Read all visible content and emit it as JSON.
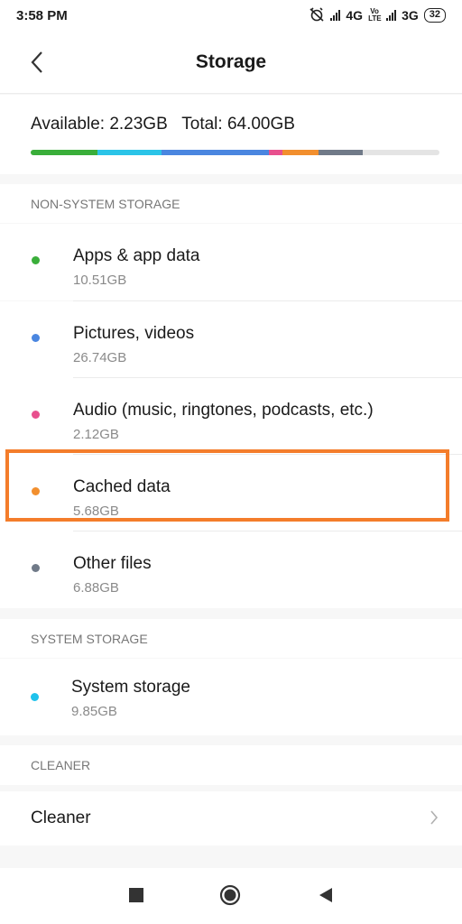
{
  "status_bar": {
    "time": "3:58 PM",
    "network_1": "4G",
    "volte": "Vo LTE",
    "network_2": "3G",
    "battery": "32"
  },
  "header": {
    "title": "Storage"
  },
  "summary": {
    "available_label": "Available: 2.23GB",
    "total_label": "Total: 64.00GB",
    "bar_segments": [
      {
        "name": "Apps & app data",
        "gb": 10.51,
        "color": "#3aae3a"
      },
      {
        "name": "Pictures, videos",
        "gb": 10.0,
        "color": "#2bc4e8"
      },
      {
        "name": "Pictures, videos (cont.)",
        "gb": 16.74,
        "color": "#4a86e0"
      },
      {
        "name": "Audio",
        "gb": 2.12,
        "color": "#e8508e"
      },
      {
        "name": "Cached data",
        "gb": 5.68,
        "color": "#f28f2e"
      },
      {
        "name": "Other files",
        "gb": 6.88,
        "color": "#707a88"
      }
    ]
  },
  "non_system": {
    "header": "NON-SYSTEM STORAGE",
    "items": [
      {
        "title": "Apps & app data",
        "size": "10.51GB",
        "color": "#3aae3a"
      },
      {
        "title": "Pictures, videos",
        "size": "26.74GB",
        "color": "#4a86e0"
      },
      {
        "title": "Audio (music, ringtones, podcasts, etc.)",
        "size": "2.12GB",
        "color": "#e8508e"
      },
      {
        "title": "Cached data",
        "size": "5.68GB",
        "color": "#f28f2e"
      },
      {
        "title": "Other files",
        "size": "6.88GB",
        "color": "#707a88"
      }
    ]
  },
  "system": {
    "header": "SYSTEM STORAGE",
    "items": [
      {
        "title": "System storage",
        "size": "9.85GB",
        "color": "#1fc2ec"
      }
    ]
  },
  "cleaner": {
    "header": "CLEANER",
    "item_label": "Cleaner"
  },
  "nav": {
    "icons": [
      "recents-square-icon",
      "home-circle-icon",
      "back-triangle-icon"
    ]
  },
  "highlight_color": "#f47d2b"
}
